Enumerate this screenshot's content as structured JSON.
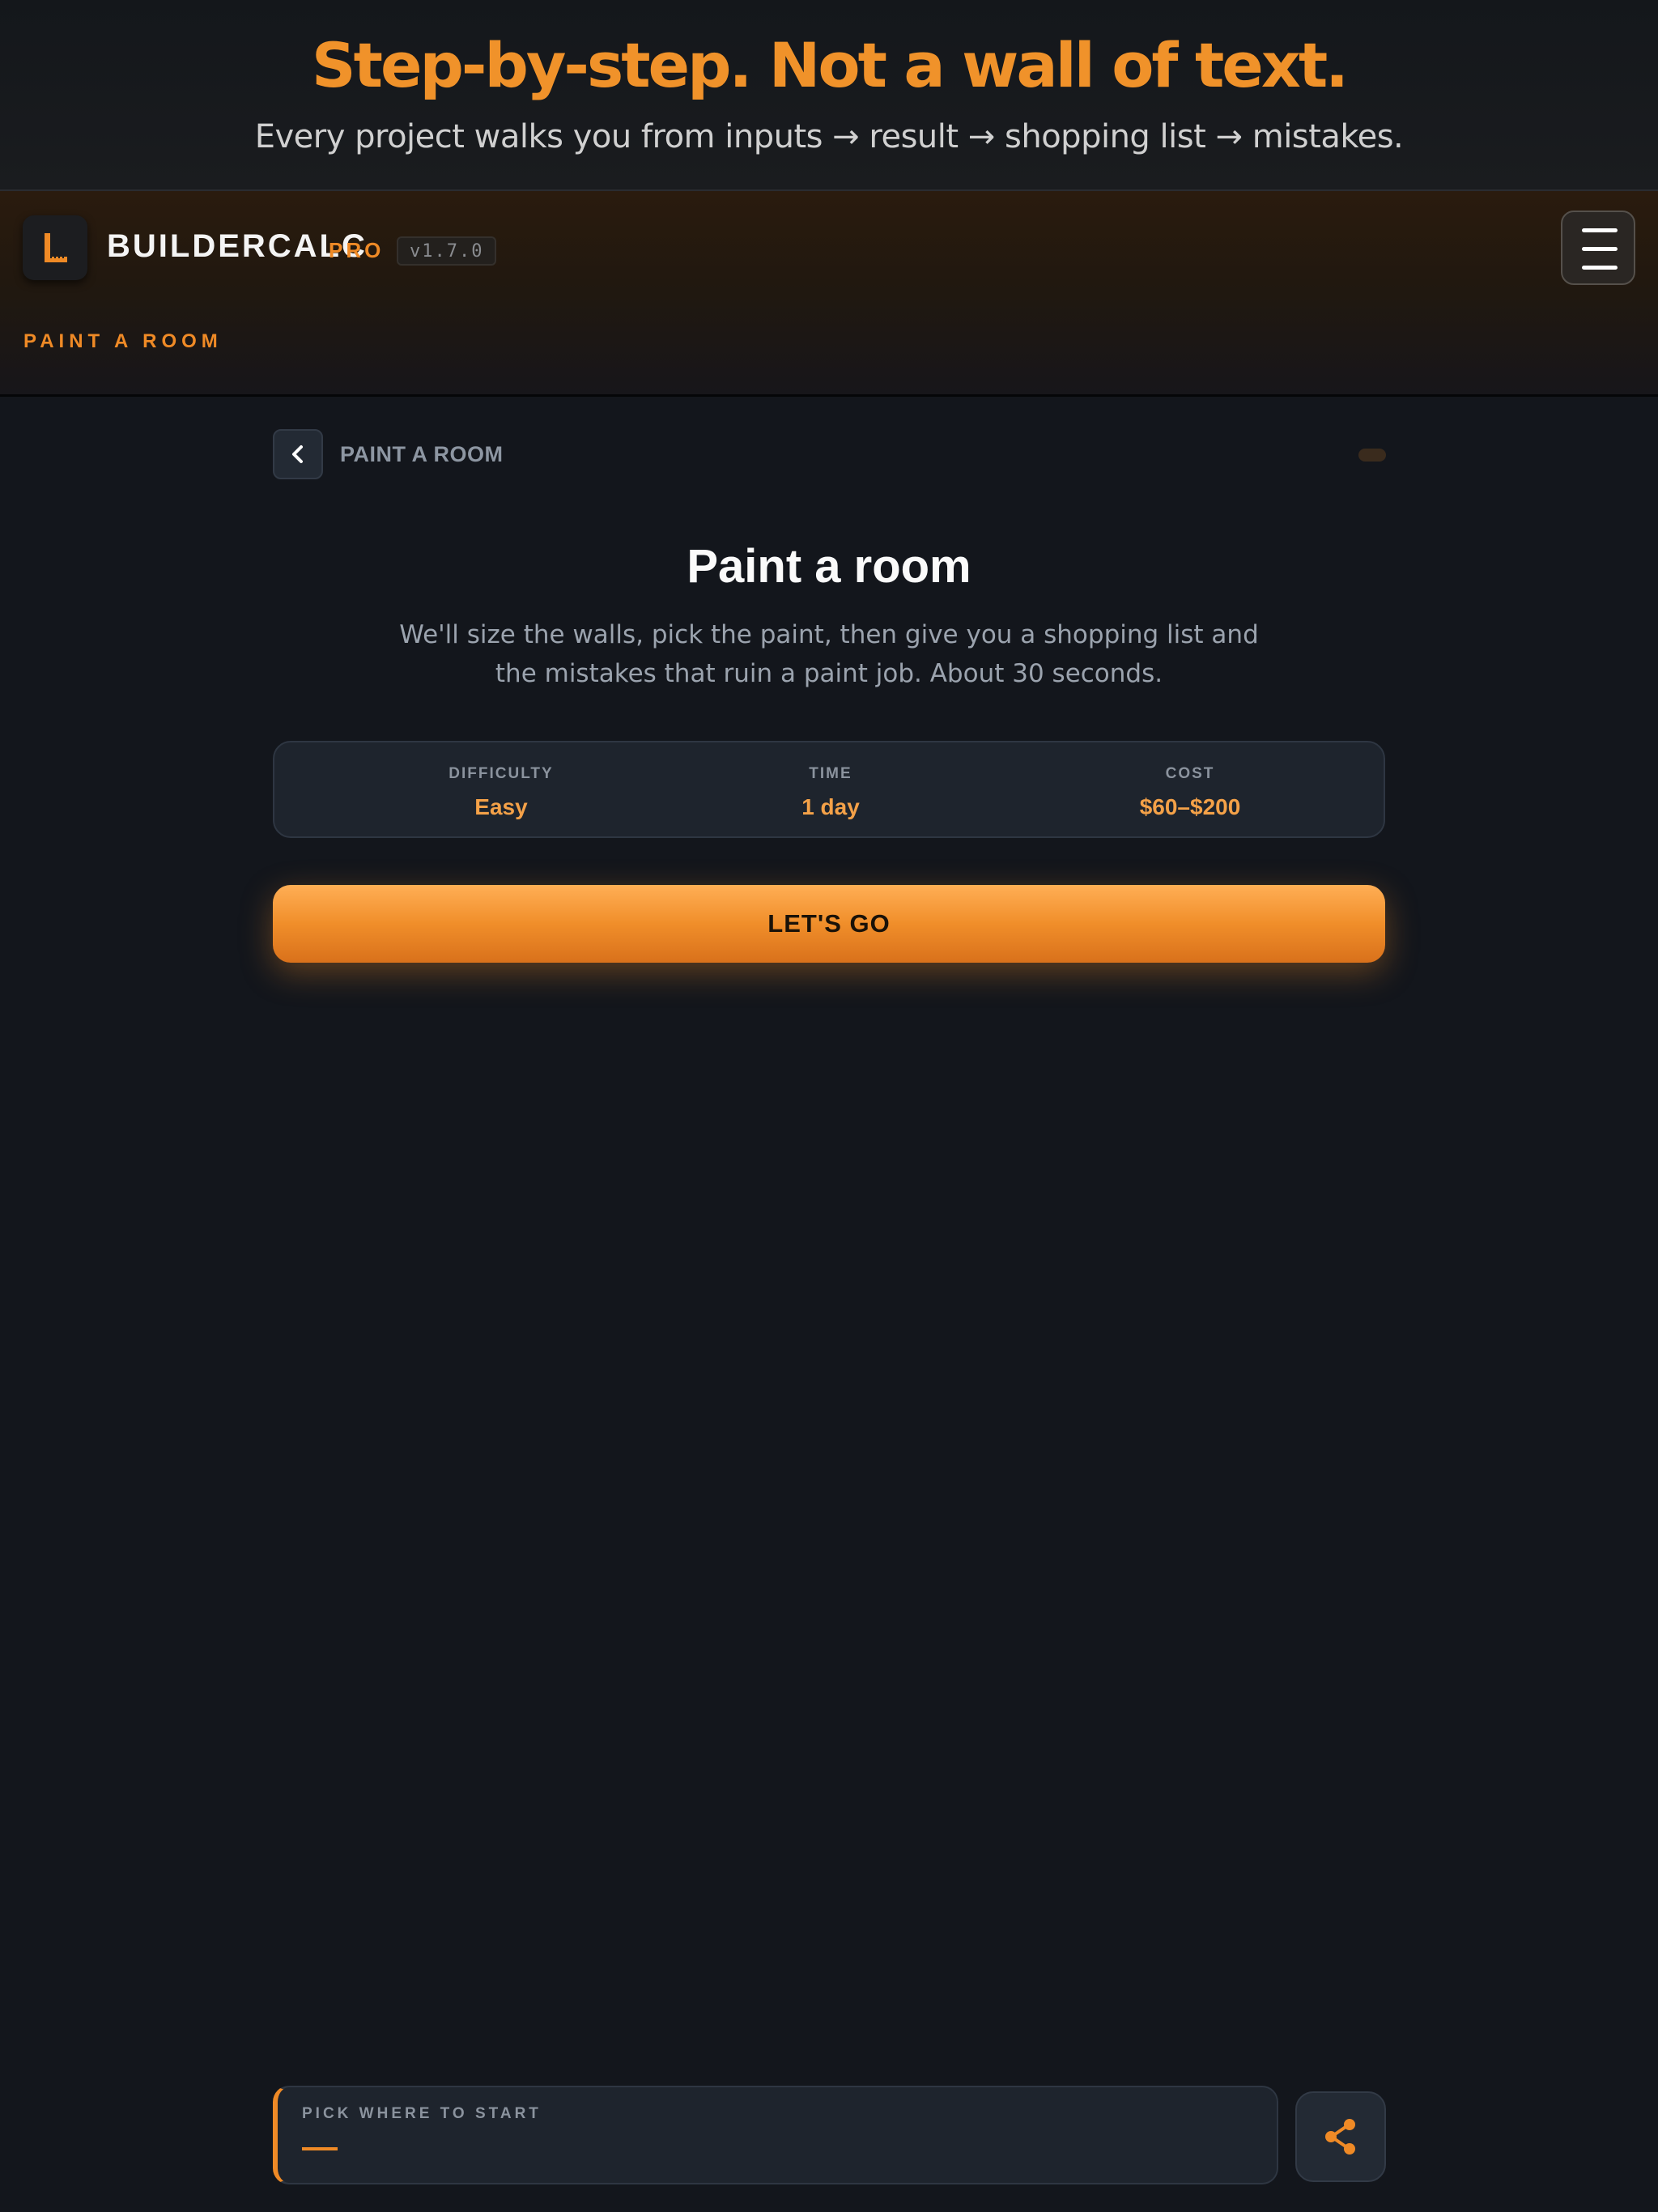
{
  "promo": {
    "title": "Step-by-step. Not a wall of text.",
    "subtitle": "Every project walks you from inputs → result → shopping list → mistakes."
  },
  "appbar": {
    "brand": "BUILDERCALC",
    "tier": "PRO",
    "version": "v1.7.0",
    "section": "PAINT A ROOM",
    "logo_icon": "carpenter-square-icon",
    "menu_icon": "hamburger-icon"
  },
  "nav": {
    "back_icon": "chevron-left-icon",
    "breadcrumb": "PAINT A ROOM"
  },
  "main": {
    "title": "Paint a room",
    "description": "We'll size the walls, pick the paint, then give you a shopping list and the mistakes that ruin a paint job. About 30 seconds.",
    "stats": [
      {
        "label": "DIFFICULTY",
        "value": "Easy"
      },
      {
        "label": "TIME",
        "value": "1 day"
      },
      {
        "label": "COST",
        "value": "$60–$200"
      }
    ],
    "cta": "LET'S GO"
  },
  "footer": {
    "start_label": "PICK WHERE TO START",
    "share_icon": "share-icon"
  },
  "colors": {
    "accent": "#ef8a26",
    "background": "#13161c",
    "card": "#1e242d"
  }
}
